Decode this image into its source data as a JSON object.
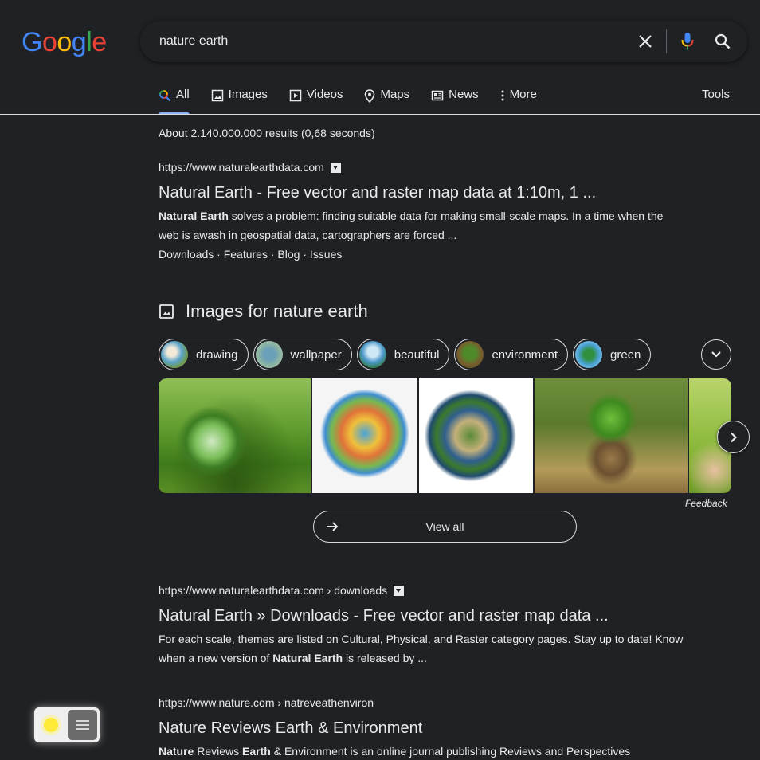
{
  "logo": {
    "text": "Google",
    "letters": [
      "G",
      "o",
      "o",
      "g",
      "l",
      "e"
    ],
    "colors": [
      "#4285f4",
      "#ea4335",
      "#fbbc05",
      "#4285f4",
      "#34a853",
      "#ea4335"
    ]
  },
  "search": {
    "query": "nature earth"
  },
  "tabs": [
    {
      "label": "All",
      "icon": "search-icon",
      "active": true
    },
    {
      "label": "Images",
      "icon": "image-icon"
    },
    {
      "label": "Videos",
      "icon": "video-icon"
    },
    {
      "label": "Maps",
      "icon": "map-pin-icon"
    },
    {
      "label": "News",
      "icon": "newspaper-icon"
    },
    {
      "label": "More",
      "icon": "more-vert-icon"
    }
  ],
  "tools_label": "Tools",
  "result_stats": "About 2.140.000.000 results (0,68 seconds)",
  "results": [
    {
      "url": "https://www.naturalearthdata.com",
      "title": "Natural Earth - Free vector and raster map data at 1:10m, 1 ...",
      "snippet_bold": "Natural Earth",
      "snippet_rest": " solves a problem: finding suitable data for making small-scale maps. In a time when the web is awash in geospatial data, cartographers are forced ...",
      "sitelinks": [
        "Downloads",
        "Features",
        "Blog",
        "Issues"
      ]
    },
    {
      "url": "https://www.naturalearthdata.com › downloads",
      "title": "Natural Earth » Downloads - Free vector and raster map data ...",
      "snippet_pre": "For each scale, themes are listed on Cultural, Physical, and Raster category pages. Stay up to date! Know when a new version of ",
      "snippet_bold": "Natural Earth",
      "snippet_post": " is released by ..."
    },
    {
      "url": "https://www.nature.com › natreveathenviron",
      "title": "Nature Reviews Earth & Environment",
      "snippet_bold1": "Nature",
      "snippet_mid": " Reviews ",
      "snippet_bold2": "Earth",
      "snippet_post": " & Environment is an online journal publishing Reviews and Perspectives"
    }
  ],
  "images_section": {
    "title": "Images for nature earth",
    "chips": [
      "drawing",
      "wallpaper",
      "beautiful",
      "environment",
      "green"
    ],
    "feedback": "Feedback",
    "view_all": "View all"
  },
  "accent": "#8ab4f8"
}
